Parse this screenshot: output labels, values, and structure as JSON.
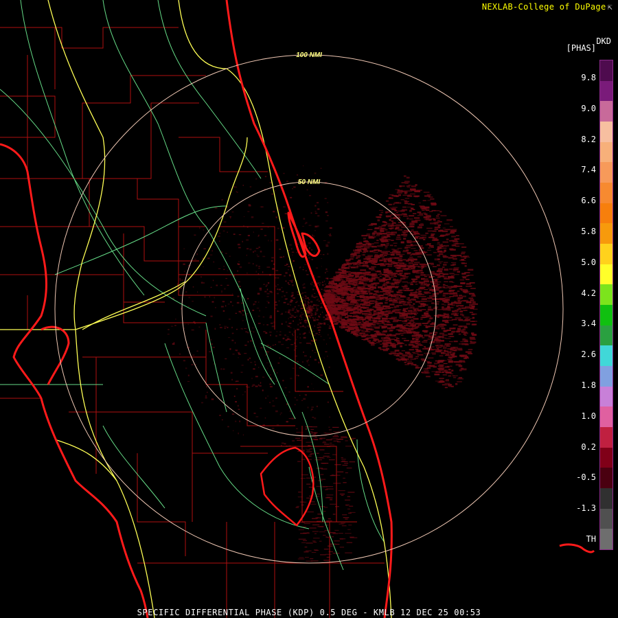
{
  "credit": "NEXLAB-College of DuPage",
  "credit_icon": "cursor-arrow-icon",
  "legend": {
    "product_code": "DKD",
    "unit": "[PHAS]",
    "ticks": [
      "9.8",
      "9.0",
      "8.2",
      "7.4",
      "6.6",
      "5.8",
      "5.0",
      "4.2",
      "3.4",
      "2.6",
      "1.8",
      "1.0",
      "0.2",
      "-0.5",
      "-1.3",
      "TH"
    ],
    "colors": [
      "#4e0b4e",
      "#7a1b7a",
      "#c86a9a",
      "#f7bfa0",
      "#f7b07a",
      "#f79a5a",
      "#f78a30",
      "#f77f0c",
      "#f79a0c",
      "#ffd21c",
      "#ffff2a",
      "#7ce41c",
      "#10c010",
      "#2aa040",
      "#40d8d8",
      "#80a0e0",
      "#c880d8",
      "#e060a0",
      "#c02040",
      "#800018",
      "#4a0010",
      "#303030",
      "#505050",
      "#6e6e6e"
    ]
  },
  "range_rings": [
    {
      "label": "100 NMI",
      "radius_nmi": 100
    },
    {
      "label": "50 NMI",
      "radius_nmi": 50
    }
  ],
  "footer": "SPECIFIC DIFFERENTIAL PHASE (KDP) 0.5 DEG - KMLB 12 DEC 25 00:53",
  "colors": {
    "coastline": "#ff1a1a",
    "county_lines": "#b01010",
    "highways": "#ffff55",
    "roads": "#66dd88",
    "range_rings": "#f0c8b4",
    "echo": "#6e0a14"
  }
}
